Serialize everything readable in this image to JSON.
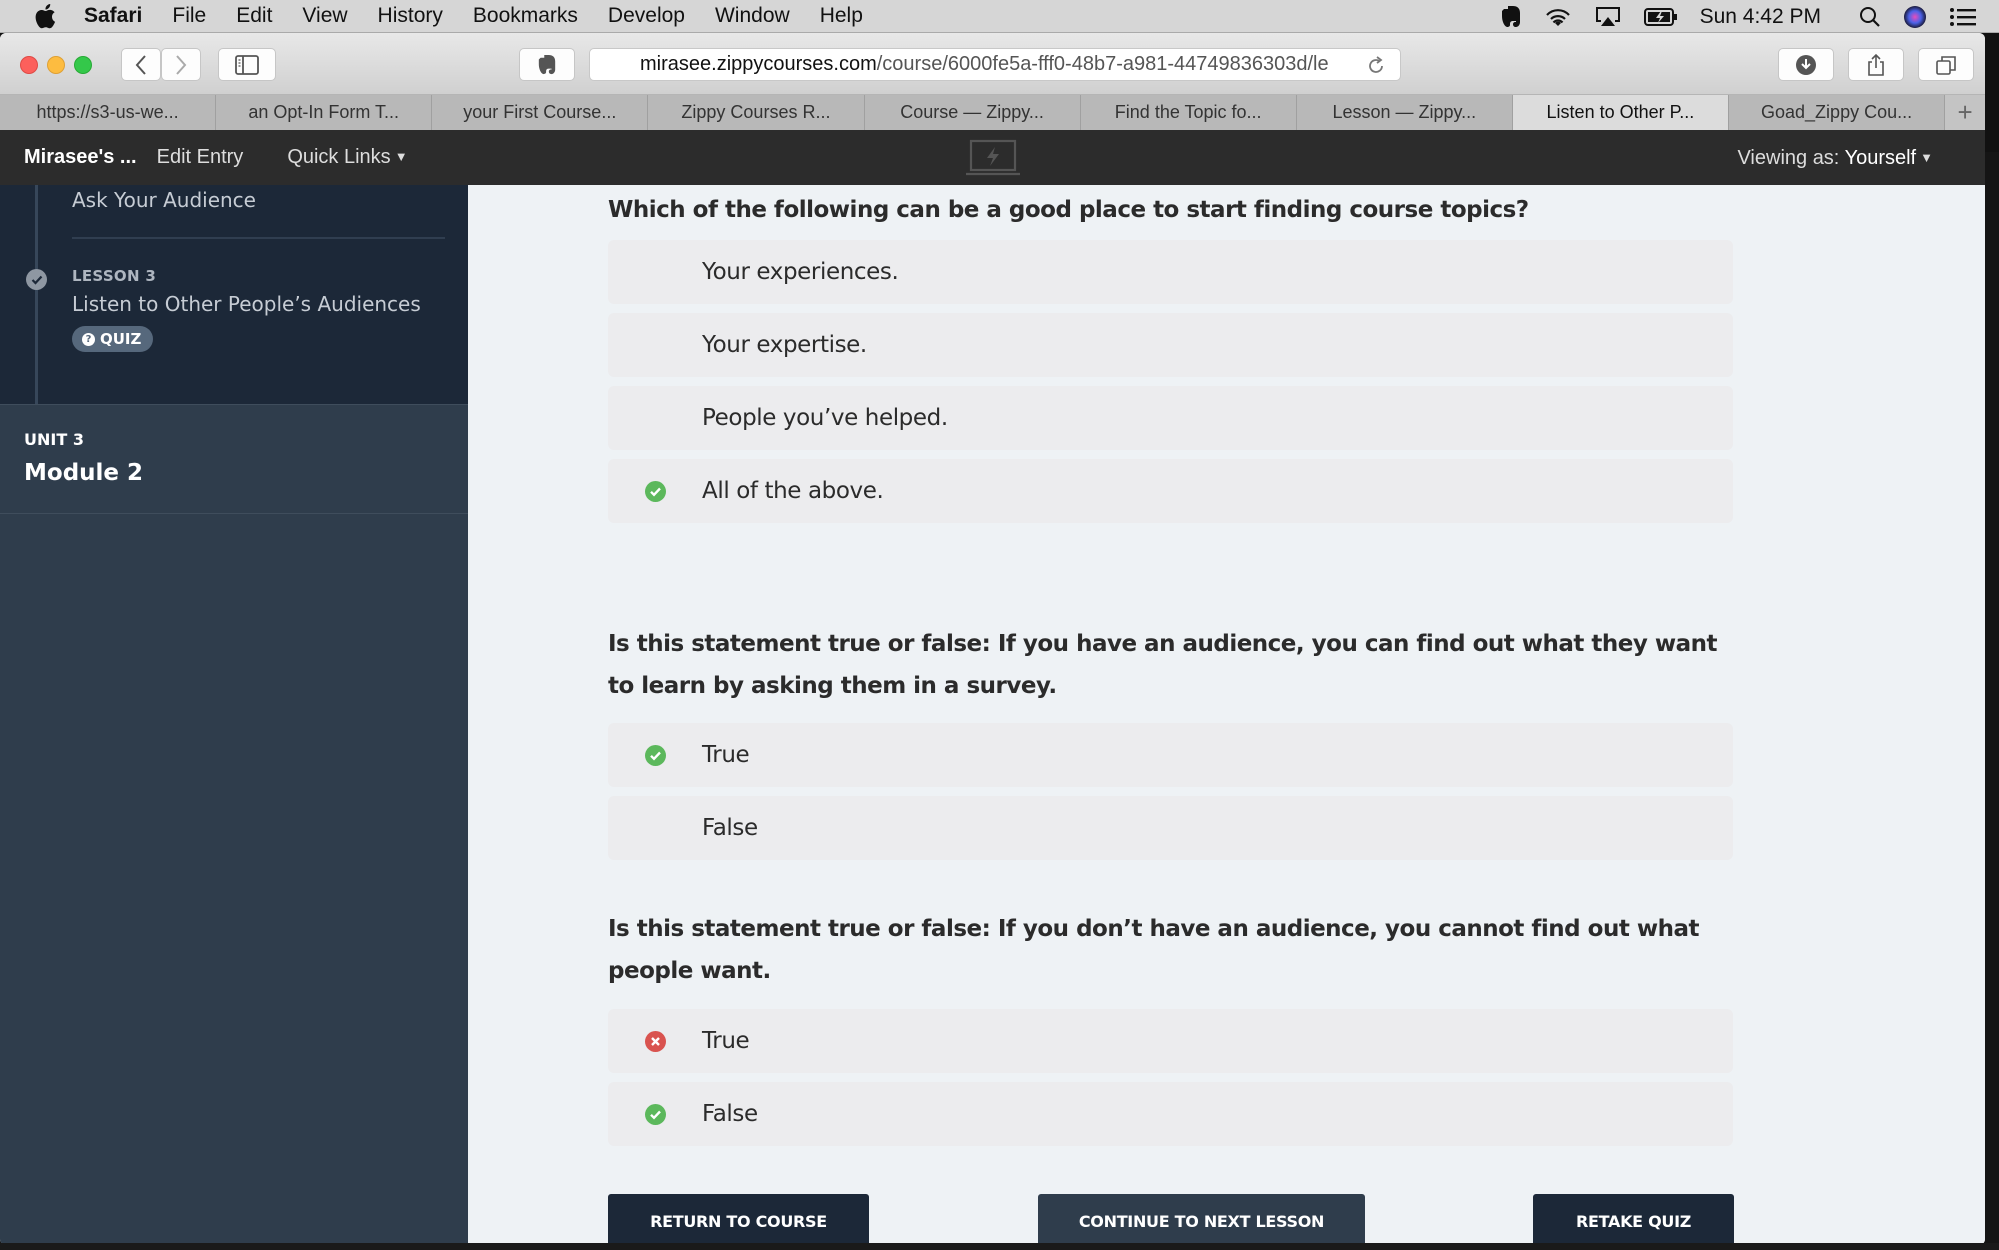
{
  "menubar": {
    "apple_icon": "apple-icon",
    "app_name": "Safari",
    "items": [
      "File",
      "Edit",
      "View",
      "History",
      "Bookmarks",
      "Develop",
      "Window",
      "Help"
    ],
    "status_icons": [
      "evernote-icon",
      "wifi-icon",
      "airplay-icon",
      "battery-charging-icon"
    ],
    "clock": "Sun 4:42 PM",
    "right_icons": [
      "spotlight-search-icon",
      "siri-icon",
      "notification-center-icon"
    ]
  },
  "browser": {
    "url_host": "mirasee.zippycourses.com",
    "url_path": "/course/6000fe5a-fff0-48b7-a981-44749836303d/le",
    "tabs": [
      {
        "label": "https://s3-us-we...",
        "active": false
      },
      {
        "label": "an Opt-In Form T...",
        "active": false
      },
      {
        "label": "your First Course...",
        "active": false
      },
      {
        "label": "Zippy Courses R...",
        "active": false
      },
      {
        "label": "Course — Zippy...",
        "active": false
      },
      {
        "label": "Find the Topic fo...",
        "active": false
      },
      {
        "label": "Lesson — Zippy...",
        "active": false
      },
      {
        "label": "Listen to Other P...",
        "active": true
      },
      {
        "label": "Goad_Zippy Cou...",
        "active": false
      }
    ],
    "new_tab_label": "+"
  },
  "adminbar": {
    "site_name": "Mirasee's ...",
    "edit_entry": "Edit Entry",
    "quick_links": "Quick Links",
    "viewing_as_label": "Viewing as:",
    "viewing_as_value": "Yourself"
  },
  "sidebar": {
    "previous_lesson_title": "Ask Your Audience",
    "current_lesson": {
      "label": "LESSON 3",
      "title": "Listen to Other People’s Audiences",
      "badge": "QUIZ",
      "completed": true
    },
    "unit": {
      "label": "UNIT 3",
      "title": "Module 2"
    }
  },
  "quiz": {
    "questions": [
      {
        "text": "Which of the following can be a good place to start finding course topics?",
        "answers": [
          {
            "text": "Your experiences.",
            "status": "none"
          },
          {
            "text": "Your expertise.",
            "status": "none"
          },
          {
            "text": "People you’ve helped.",
            "status": "none"
          },
          {
            "text": "All of the above.",
            "status": "correct"
          }
        ]
      },
      {
        "text": "Is this statement true or false: If you have an audience, you can find out what they want to learn by asking them in a survey.",
        "answers": [
          {
            "text": "True",
            "status": "correct"
          },
          {
            "text": "False",
            "status": "none"
          }
        ]
      },
      {
        "text": "Is this statement true or false: If you don’t have an audience, you cannot find out what people want.",
        "answers": [
          {
            "text": "True",
            "status": "incorrect"
          },
          {
            "text": "False",
            "status": "correct"
          }
        ]
      }
    ],
    "buttons": {
      "return": "RETURN TO COURSE",
      "next": "CONTINUE TO NEXT LESSON",
      "retake": "RETAKE QUIZ"
    }
  },
  "colors": {
    "correct": "#5cb85c",
    "incorrect": "#d9534f",
    "sidebar_dark": "#1c2838",
    "sidebar": "#2f3d4c",
    "content_bg": "#eef2f5",
    "answer_bg": "#ececee"
  }
}
